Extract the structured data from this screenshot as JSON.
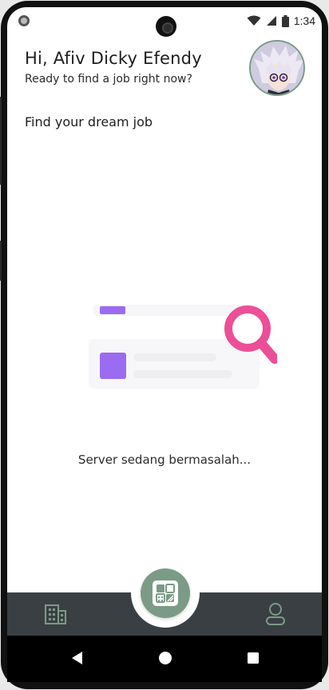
{
  "status_bar": {
    "time": "1:34",
    "icons": [
      "wifi-icon",
      "cellular-signal-icon",
      "battery-icon"
    ]
  },
  "header": {
    "greeting": "Hi, Afiv Dicky Efendy",
    "subtitle": "Ready to find a job right now?"
  },
  "section": {
    "title": "Find your dream job"
  },
  "empty_state": {
    "message": "Server sedang bermasalah..."
  },
  "bottom_nav": {
    "items": [
      {
        "icon": "building-icon",
        "active": false
      },
      {
        "icon": "grid-cards-icon",
        "active": true
      },
      {
        "icon": "user-icon",
        "active": false
      }
    ]
  },
  "system_nav": {
    "icons": [
      "back-icon",
      "home-icon",
      "recents-icon"
    ]
  },
  "colors": {
    "accent": "#7b9b86",
    "nav_background": "#3a3f44",
    "illustration_purple": "#9b6cf0",
    "illustration_pink": "#ec4f97"
  }
}
